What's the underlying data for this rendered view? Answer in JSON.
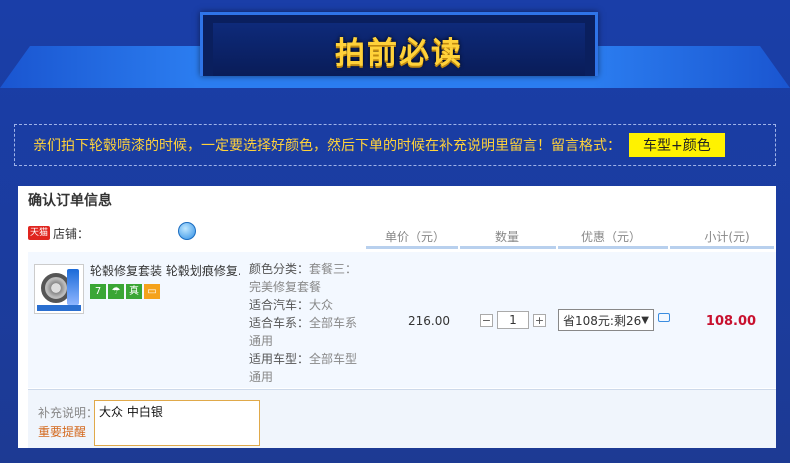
{
  "header": {
    "title": "拍前必读"
  },
  "notice": {
    "text": "亲们拍下轮毂喷漆的时候，一定要选择好颜色，然后下单的时候在补充说明里留言！留言格式：",
    "format_tag": "车型+颜色"
  },
  "order": {
    "title": "确认订单信息",
    "store": {
      "badge": "天猫",
      "label": "店铺："
    },
    "columns": {
      "unit_price": "单价（元）",
      "quantity": "数量",
      "discount": "优惠（元）",
      "subtotal": "小计(元)"
    },
    "item": {
      "name": "轮毂修复套装 轮毂划痕修复...",
      "badges": [
        "7",
        "",
        "真",
        ""
      ],
      "specs": [
        {
          "key": "颜色分类：",
          "value": "套餐三：完美修复套餐"
        },
        {
          "key": "适合汽车：",
          "value": "大众"
        },
        {
          "key": "适合车系：",
          "value": "全部车系通用"
        },
        {
          "key": "适用车型：",
          "value": "全部车型通用"
        }
      ],
      "unit_price": "216.00",
      "quantity": "1",
      "minus": "−",
      "plus": "+",
      "discount_selected": "省108元:剩26",
      "subtotal": "108.00"
    },
    "note": {
      "label": "补充说明：",
      "warning": "重要提醒",
      "value": "大众 中白银"
    }
  }
}
